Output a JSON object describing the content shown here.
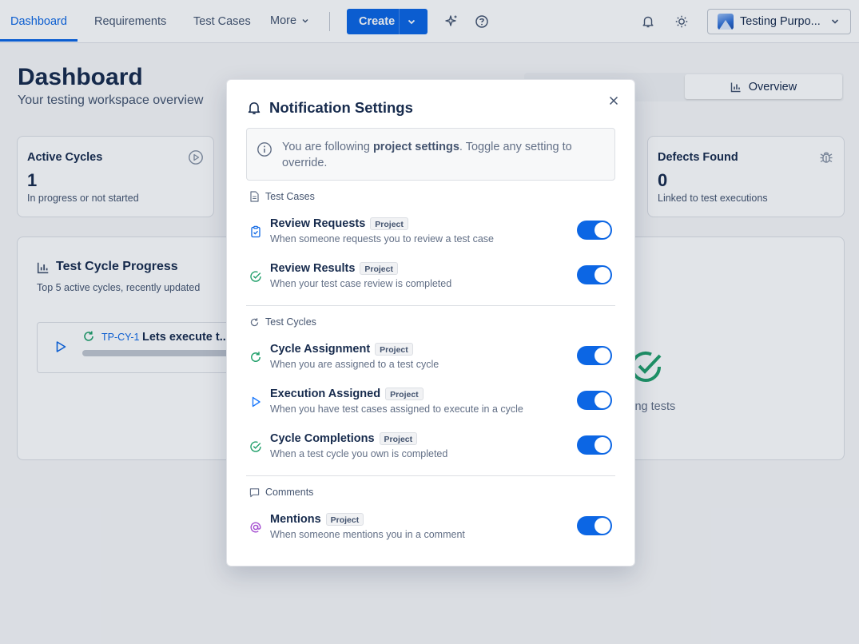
{
  "nav": {
    "tabs": [
      {
        "label": "Dashboard",
        "active": true
      },
      {
        "label": "Requirements"
      },
      {
        "label": "Test Cases"
      },
      {
        "label": "More"
      }
    ],
    "create_label": "Create",
    "project_name": "Testing Purpo..."
  },
  "page": {
    "title": "Dashboard",
    "subtitle": "Your testing workspace overview",
    "view_toggle_active": "Overview"
  },
  "cards": {
    "active_cycles": {
      "title": "Active Cycles",
      "value": "1",
      "caption": "In progress or not started"
    },
    "defects_found": {
      "title": "Defects Found",
      "value": "0",
      "caption": "Linked to test executions"
    }
  },
  "progress": {
    "title": "Test Cycle Progress",
    "subtitle": "Top 5 active cycles, recently updated",
    "cycles": [
      {
        "key": "TP-CY-1",
        "name": "Lets execute t..."
      }
    ],
    "passing_text": "ling tests"
  },
  "modal": {
    "title": "Notification Settings",
    "info": {
      "prefix": "You are following ",
      "emphasis": "project settings",
      "suffix": ". Toggle any setting to override."
    },
    "sections": [
      {
        "title": "Test Cases",
        "icon": "document-icon",
        "settings": [
          {
            "title": "Review Requests",
            "badge": "Project",
            "description": "When someone requests you to review a test case",
            "icon": "clipboard-check-icon",
            "color": "#0c66e4",
            "enabled": true
          },
          {
            "title": "Review Results",
            "badge": "Project",
            "description": "When your test case review is completed",
            "icon": "check-circle-icon",
            "color": "#22a06b",
            "enabled": true
          }
        ]
      },
      {
        "title": "Test Cycles",
        "icon": "refresh-icon",
        "settings": [
          {
            "title": "Cycle Assignment",
            "badge": "Project",
            "description": "When you are assigned to a test cycle",
            "icon": "refresh-icon",
            "color": "#22a06b",
            "enabled": true
          },
          {
            "title": "Execution Assigned",
            "badge": "Project",
            "description": "When you have test cases assigned to execute in a cycle",
            "icon": "play-icon",
            "color": "#1d7afc",
            "enabled": true
          },
          {
            "title": "Cycle Completions",
            "badge": "Project",
            "description": "When a test cycle you own is completed",
            "icon": "check-circle-icon",
            "color": "#22a06b",
            "enabled": true
          }
        ]
      },
      {
        "title": "Comments",
        "icon": "comment-icon",
        "settings": [
          {
            "title": "Mentions",
            "badge": "Project",
            "description": "When someone mentions you in a comment",
            "icon": "at-sign-icon",
            "color": "#a54fd1",
            "enabled": true
          }
        ]
      }
    ]
  },
  "colors": {
    "accent": "#0c66e4",
    "success": "#22a06b",
    "mention": "#a54fd1",
    "toggle_on": "#0c66e4"
  }
}
